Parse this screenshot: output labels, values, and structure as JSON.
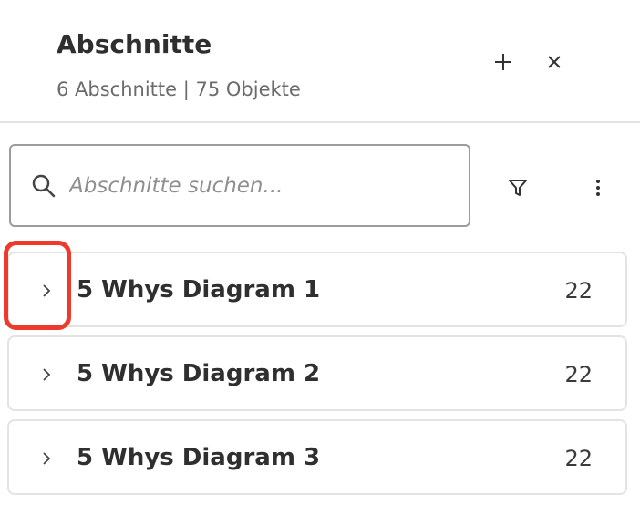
{
  "header": {
    "title": "Abschnitte",
    "subtitle": "6 Abschnitte | 75 Objekte",
    "add_icon": "plus-icon",
    "close_icon": "close-icon"
  },
  "search": {
    "placeholder": "Abschnitte suchen...",
    "value": "",
    "icon": "search-icon"
  },
  "toolbar": {
    "filter_icon": "filter-icon",
    "more_icon": "more-vertical-icon"
  },
  "sections": [
    {
      "name": "5 Whys Diagram 1",
      "count": "22"
    },
    {
      "name": "5 Whys Diagram 2",
      "count": "22"
    },
    {
      "name": "5 Whys Diagram 3",
      "count": "22"
    }
  ],
  "colors": {
    "highlight": "#ee3a2c",
    "border": "#e3e3e3",
    "text": "#2f2f2f",
    "muted": "#6b6b6b"
  }
}
